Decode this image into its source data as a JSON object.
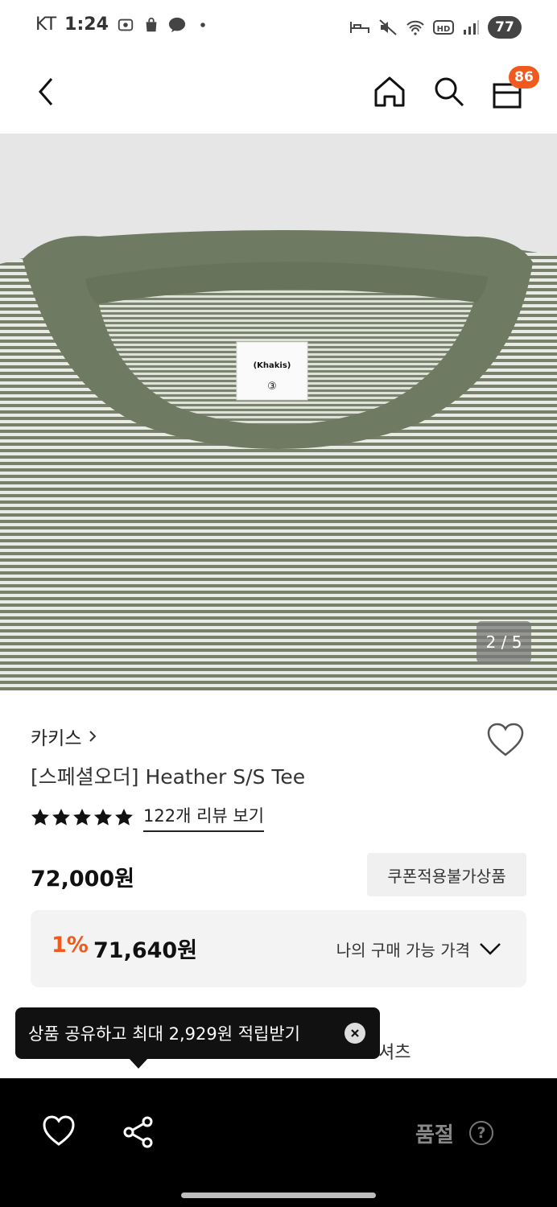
{
  "status_bar": {
    "carrier": "KT",
    "time": "1:24",
    "battery": "77"
  },
  "header": {
    "cart_count": "86"
  },
  "gallery": {
    "counter": "2 / 5",
    "label_text": "(Khakis)",
    "label_size": "③"
  },
  "product": {
    "brand": "카키스",
    "title": "[스페셜오더] Heather S/S Tee",
    "rating_stars": 5,
    "review_link": "122개 리뷰 보기",
    "price": "72,000원",
    "coupon_badge": "쿠폰적용불가상품",
    "discount_percent": "1%",
    "my_price": "71,640원",
    "my_price_label": "나의 구매 가능 가격",
    "category_peek": "셔츠"
  },
  "tooltip": {
    "text": "상품 공유하고 최대 2,929원 적립받기"
  },
  "bottom_bar": {
    "status_label": "품절",
    "help_symbol": "?"
  },
  "colors": {
    "accent": "#f05a1e",
    "shirt_green": "#6f7a62",
    "stripe_light": "#e9ebe4"
  }
}
